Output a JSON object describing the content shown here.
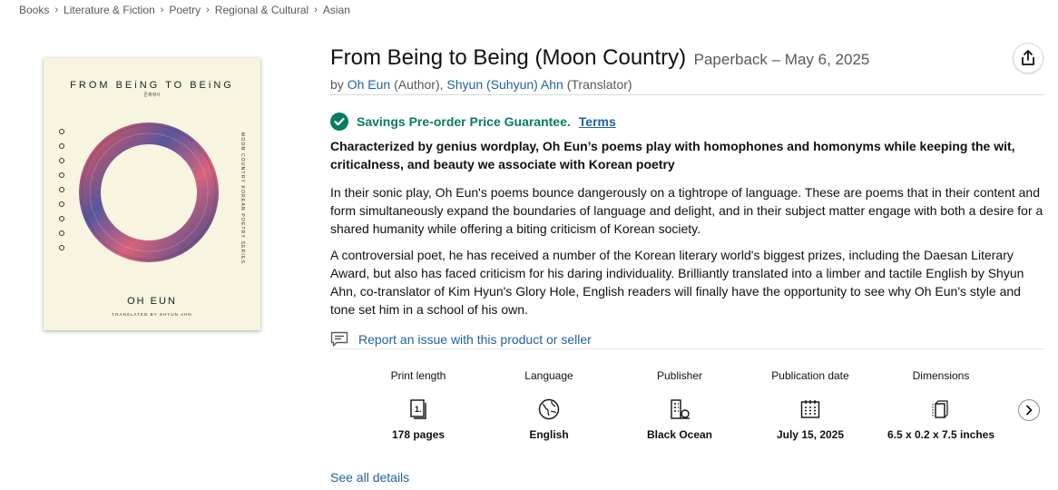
{
  "breadcrumb": [
    "Books",
    "Literature & Fiction",
    "Poetry",
    "Regional & Cultural",
    "Asian"
  ],
  "cover": {
    "title": "FROM BEiNG TO BEiNG",
    "subtitle": "존재에서",
    "series": "MOON COUNTRY KOREAN POETRY SERIES",
    "author": "OH EUN",
    "translator": "TRANSLATED BY SHYUN AHN"
  },
  "product": {
    "title": "From Being to Being (Moon Country)",
    "format": "Paperback – May 6, 2025",
    "by": "by",
    "author_name": "Oh Eun",
    "author_role": "(Author),",
    "translator_name": "Shyun (Suhyun) Ahn",
    "translator_role": "(Translator)"
  },
  "guarantee": {
    "text": "Savings Pre-order Price Guarantee.",
    "terms": "Terms"
  },
  "description": {
    "headline": "Characterized by genius wordplay, Oh Eun’s poems play with homophones and homonyms while keeping the wit, criticalness, and beauty we associate with Korean poetry",
    "p1": "In their sonic play, Oh Eun's poems bounce dangerously on a tightrope of language. These are poems that in their content and form simultaneously expand the boundaries of language and delight, and in their subject matter engage with both a desire for a shared humanity while offering a biting criticism of Korean society.",
    "p2": "A controversial poet, he has received a number of the Korean literary world's biggest prizes, including the Daesan Literary Award, but also has faced criticism for his daring individuality. Brilliantly translated into a limber and tactile English by Shyun Ahn, co-translator of Kim Hyun's Glory Hole, English readers will finally have the opportunity to see why Oh Eun's style and tone set him in a school of his own."
  },
  "report_link": "Report an issue with this product or seller",
  "details": [
    {
      "label": "Print length",
      "value": "178 pages",
      "icon": "pages-icon"
    },
    {
      "label": "Language",
      "value": "English",
      "icon": "globe-icon"
    },
    {
      "label": "Publisher",
      "value": "Black Ocean",
      "icon": "building-icon"
    },
    {
      "label": "Publication date",
      "value": "July 15, 2025",
      "icon": "calendar-icon"
    },
    {
      "label": "Dimensions",
      "value": "6.5 x 0.2 x 7.5 inches",
      "icon": "dimensions-icon"
    }
  ],
  "see_all": "See all details"
}
